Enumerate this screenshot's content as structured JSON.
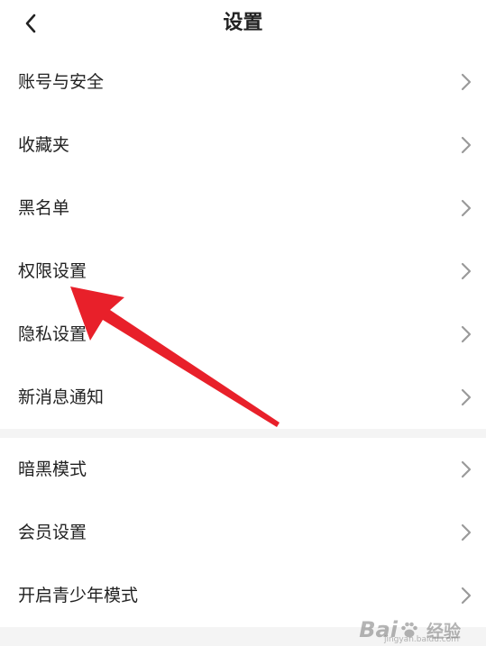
{
  "header": {
    "title": "设置"
  },
  "menu_groups": [
    {
      "items": [
        {
          "label": "账号与安全"
        },
        {
          "label": "收藏夹"
        },
        {
          "label": "黑名单"
        },
        {
          "label": "权限设置"
        },
        {
          "label": "隐私设置"
        },
        {
          "label": "新消息通知"
        }
      ]
    },
    {
      "items": [
        {
          "label": "暗黑模式"
        },
        {
          "label": "会员设置"
        },
        {
          "label": "开启青少年模式"
        }
      ]
    }
  ],
  "annotation": {
    "color": "#e8202a"
  },
  "watermark": {
    "brand": "Bai",
    "brand_tail": "经验",
    "url": "jingyan.baidu.com"
  },
  "colors": {
    "text": "#222222",
    "chevron": "#9a9a9a",
    "separator": "#f4f4f4"
  }
}
